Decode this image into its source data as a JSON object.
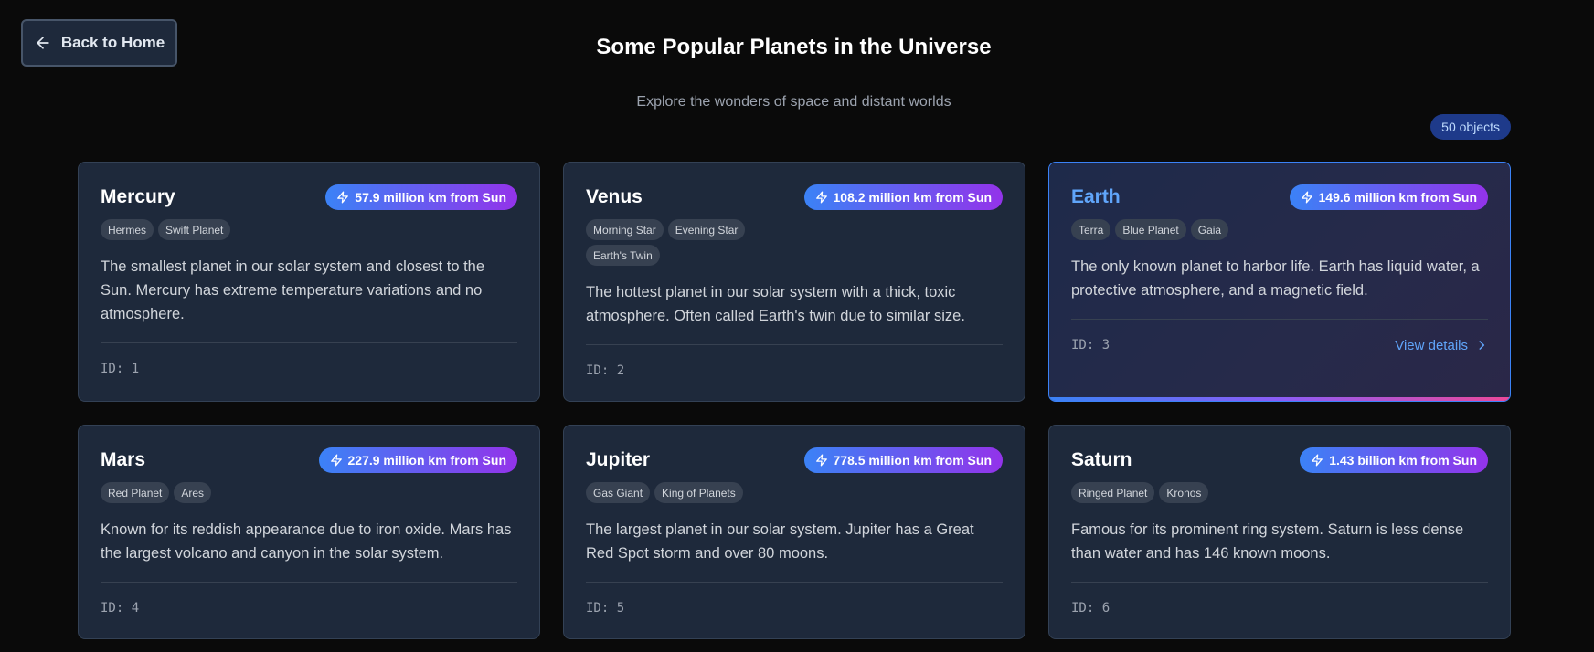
{
  "header": {
    "back_label": "Back to Home",
    "title": "Some Popular Planets in the Universe",
    "subtitle": "Explore the wonders of space and distant worlds",
    "count": "50 objects"
  },
  "accent": {
    "primary": "#3b82f6",
    "secondary": "#9333ea",
    "link": "#60a5fa"
  },
  "planets": [
    {
      "name": "Mercury",
      "distance": "57.9 million km from Sun",
      "tags": [
        "Hermes",
        "Swift Planet"
      ],
      "description": "The smallest planet in our solar system and closest to the Sun. Mercury has extreme temperature variations and no atmosphere.",
      "id": "ID: 1"
    },
    {
      "name": "Venus",
      "distance": "108.2 million km from Sun",
      "tags": [
        "Morning Star",
        "Evening Star",
        "Earth's Twin"
      ],
      "description": "The hottest planet in our solar system with a thick, toxic atmosphere. Often called Earth's twin due to similar size.",
      "id": "ID: 2"
    },
    {
      "name": "Earth",
      "distance": "149.6 million km from Sun",
      "tags": [
        "Terra",
        "Blue Planet",
        "Gaia"
      ],
      "description": "The only known planet to harbor life. Earth has liquid water, a protective atmosphere, and a magnetic field.",
      "id": "ID: 3",
      "details_label": "View details"
    },
    {
      "name": "Mars",
      "distance": "227.9 million km from Sun",
      "tags": [
        "Red Planet",
        "Ares"
      ],
      "description": "Known for its reddish appearance due to iron oxide. Mars has the largest volcano and canyon in the solar system.",
      "id": "ID: 4"
    },
    {
      "name": "Jupiter",
      "distance": "778.5 million km from Sun",
      "tags": [
        "Gas Giant",
        "King of Planets"
      ],
      "description": "The largest planet in our solar system. Jupiter has a Great Red Spot storm and over 80 moons.",
      "id": "ID: 5"
    },
    {
      "name": "Saturn",
      "distance": "1.43 billion km from Sun",
      "tags": [
        "Ringed Planet",
        "Kronos"
      ],
      "description": "Famous for its prominent ring system. Saturn is less dense than water and has 146 known moons.",
      "id": "ID: 6"
    }
  ]
}
